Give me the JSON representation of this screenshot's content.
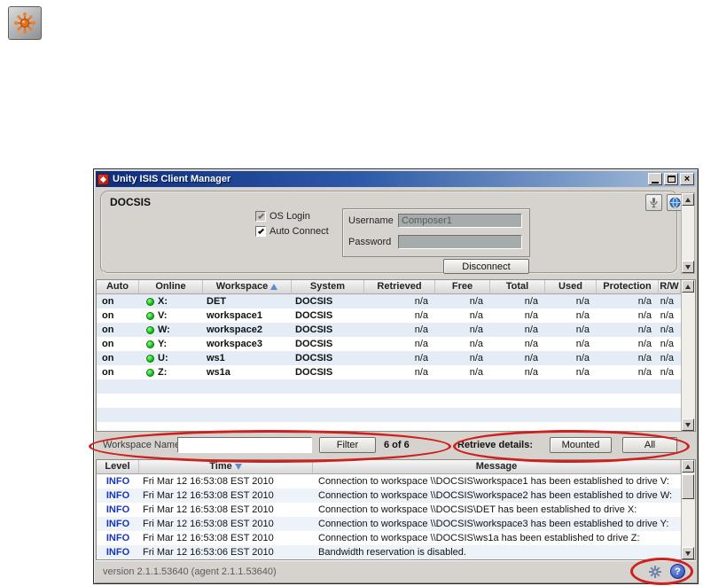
{
  "app_icon": {
    "name": "Unity ISIS Client Manager launcher"
  },
  "window": {
    "title": "Unity ISIS Client Manager",
    "close_glyph": "×"
  },
  "connection": {
    "system_name": "DOCSIS",
    "os_login": {
      "label": "OS Login",
      "checked": true,
      "enabled": false
    },
    "auto_connect": {
      "label": "Auto Connect",
      "checked": true,
      "enabled": true
    },
    "username_label": "Username",
    "username_value": "Composer1",
    "password_label": "Password",
    "password_value": "",
    "disconnect_button": "Disconnect"
  },
  "workspace_table": {
    "columns": [
      "Auto",
      "Online",
      "Workspace",
      "System",
      "Retrieved",
      "Free",
      "Total",
      "Used",
      "Protection",
      "R/W"
    ],
    "sort": {
      "column": "Workspace",
      "direction": "ascending"
    },
    "rows": [
      {
        "auto": "on",
        "online": true,
        "drive": "X:",
        "workspace": "DET",
        "system": "DOCSIS",
        "retrieved": "n/a",
        "free": "n/a",
        "total": "n/a",
        "used": "n/a",
        "protection": "n/a",
        "rw": "n/a"
      },
      {
        "auto": "on",
        "online": true,
        "drive": "V:",
        "workspace": "workspace1",
        "system": "DOCSIS",
        "retrieved": "n/a",
        "free": "n/a",
        "total": "n/a",
        "used": "n/a",
        "protection": "n/a",
        "rw": "n/a"
      },
      {
        "auto": "on",
        "online": true,
        "drive": "W:",
        "workspace": "workspace2",
        "system": "DOCSIS",
        "retrieved": "n/a",
        "free": "n/a",
        "total": "n/a",
        "used": "n/a",
        "protection": "n/a",
        "rw": "n/a"
      },
      {
        "auto": "on",
        "online": true,
        "drive": "Y:",
        "workspace": "workspace3",
        "system": "DOCSIS",
        "retrieved": "n/a",
        "free": "n/a",
        "total": "n/a",
        "used": "n/a",
        "protection": "n/a",
        "rw": "n/a"
      },
      {
        "auto": "on",
        "online": true,
        "drive": "U:",
        "workspace": "ws1",
        "system": "DOCSIS",
        "retrieved": "n/a",
        "free": "n/a",
        "total": "n/a",
        "used": "n/a",
        "protection": "n/a",
        "rw": "n/a"
      },
      {
        "auto": "on",
        "online": true,
        "drive": "Z:",
        "workspace": "ws1a",
        "system": "DOCSIS",
        "retrieved": "n/a",
        "free": "n/a",
        "total": "n/a",
        "used": "n/a",
        "protection": "n/a",
        "rw": "n/a"
      }
    ]
  },
  "filter_bar": {
    "label": "Workspace Name",
    "input_value": "",
    "filter_button": "Filter",
    "count": "6 of 6",
    "retrieve_label": "Retrieve details:",
    "mounted_button": "Mounted",
    "all_button": "All"
  },
  "log_table": {
    "columns": [
      "Level",
      "Time",
      "Message"
    ],
    "sort": {
      "column": "Time",
      "direction": "descending"
    },
    "rows": [
      {
        "level": "INFO",
        "time": "Fri Mar 12 16:53:08 EST 2010",
        "message": "Connection to workspace \\\\DOCSIS\\workspace1 has been established to drive V:"
      },
      {
        "level": "INFO",
        "time": "Fri Mar 12 16:53:08 EST 2010",
        "message": "Connection to workspace \\\\DOCSIS\\workspace2 has been established to drive W:"
      },
      {
        "level": "INFO",
        "time": "Fri Mar 12 16:53:08 EST 2010",
        "message": "Connection to workspace \\\\DOCSIS\\DET has been established to drive X:"
      },
      {
        "level": "INFO",
        "time": "Fri Mar 12 16:53:08 EST 2010",
        "message": "Connection to workspace \\\\DOCSIS\\workspace3 has been established to drive Y:"
      },
      {
        "level": "INFO",
        "time": "Fri Mar 12 16:53:08 EST 2010",
        "message": "Connection to workspace \\\\DOCSIS\\ws1a has been established to drive Z:"
      },
      {
        "level": "INFO",
        "time": "Fri Mar 12 16:53:06 EST 2010",
        "message": "Bandwidth reservation is disabled."
      }
    ]
  },
  "status_bar": {
    "version_text": "version 2.1.1.53640 (agent 2.1.1.53640)",
    "help_glyph": "?"
  }
}
